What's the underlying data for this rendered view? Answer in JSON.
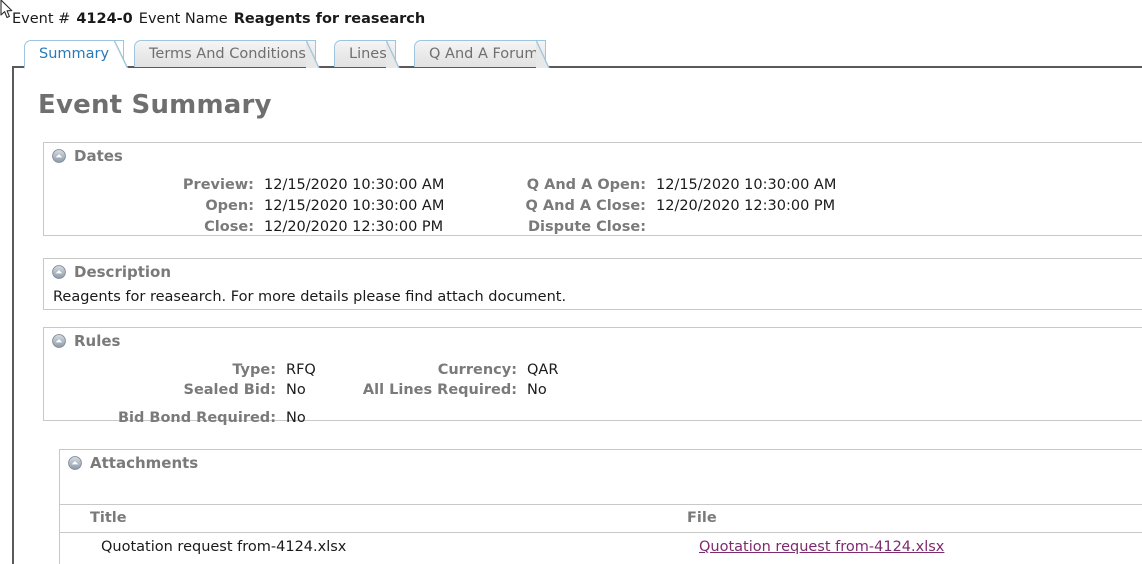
{
  "header": {
    "event_num_label": "Event #",
    "event_num_value": "4124-0",
    "event_name_label": "Event Name",
    "event_name_value": "Reagents for reasearch"
  },
  "tabs": [
    {
      "label": "Summary",
      "active": true,
      "name": "tab-summary"
    },
    {
      "label": "Terms And Conditions",
      "active": false,
      "name": "tab-terms-and-conditions"
    },
    {
      "label": "Lines",
      "active": false,
      "name": "tab-lines"
    },
    {
      "label": "Q And A Forum",
      "active": false,
      "name": "tab-q-and-a-forum"
    }
  ],
  "page_title": "Event Summary",
  "sections": {
    "dates": {
      "title": "Dates",
      "icon": "collapse-circle-icon",
      "left": [
        {
          "label": "Preview:",
          "value": "12/15/2020 10:30:00 AM"
        },
        {
          "label": "Open:",
          "value": "12/15/2020 10:30:00 AM"
        },
        {
          "label": "Close:",
          "value": "12/20/2020 12:30:00 PM"
        }
      ],
      "right": [
        {
          "label": "Q And A Open:",
          "value": "12/15/2020 10:30:00 AM"
        },
        {
          "label": "Q And A Close:",
          "value": "12/20/2020 12:30:00 PM"
        },
        {
          "label": "Dispute Close:",
          "value": ""
        }
      ]
    },
    "description": {
      "title": "Description",
      "icon": "collapse-circle-icon",
      "text": "Reagents for reasearch. For more details please find attach document."
    },
    "rules": {
      "title": "Rules",
      "icon": "collapse-circle-icon",
      "left": [
        {
          "label": "Type:",
          "value": "RFQ"
        },
        {
          "label": "Sealed Bid:",
          "value": "No"
        },
        {
          "label": "Bid Bond Required:",
          "value": "No"
        }
      ],
      "right": [
        {
          "label": "Currency:",
          "value": "QAR"
        },
        {
          "label": "All Lines Required:",
          "value": "No"
        },
        {
          "label": "",
          "value": ""
        }
      ]
    },
    "attachments": {
      "title": "Attachments",
      "icon": "collapse-circle-icon",
      "columns": [
        "Title",
        "File"
      ],
      "rows": [
        {
          "title": "Quotation request from-4124.xlsx",
          "file": "Quotation request from-4124.xlsx"
        }
      ]
    }
  },
  "colors": {
    "active_tab_text": "#2b7ab8",
    "section_label": "#7a7a7a",
    "link": "#7d2a6e",
    "page_title": "#6f6f6f",
    "border": "#c9c9c9",
    "panel_border": "#5a5a5a"
  }
}
